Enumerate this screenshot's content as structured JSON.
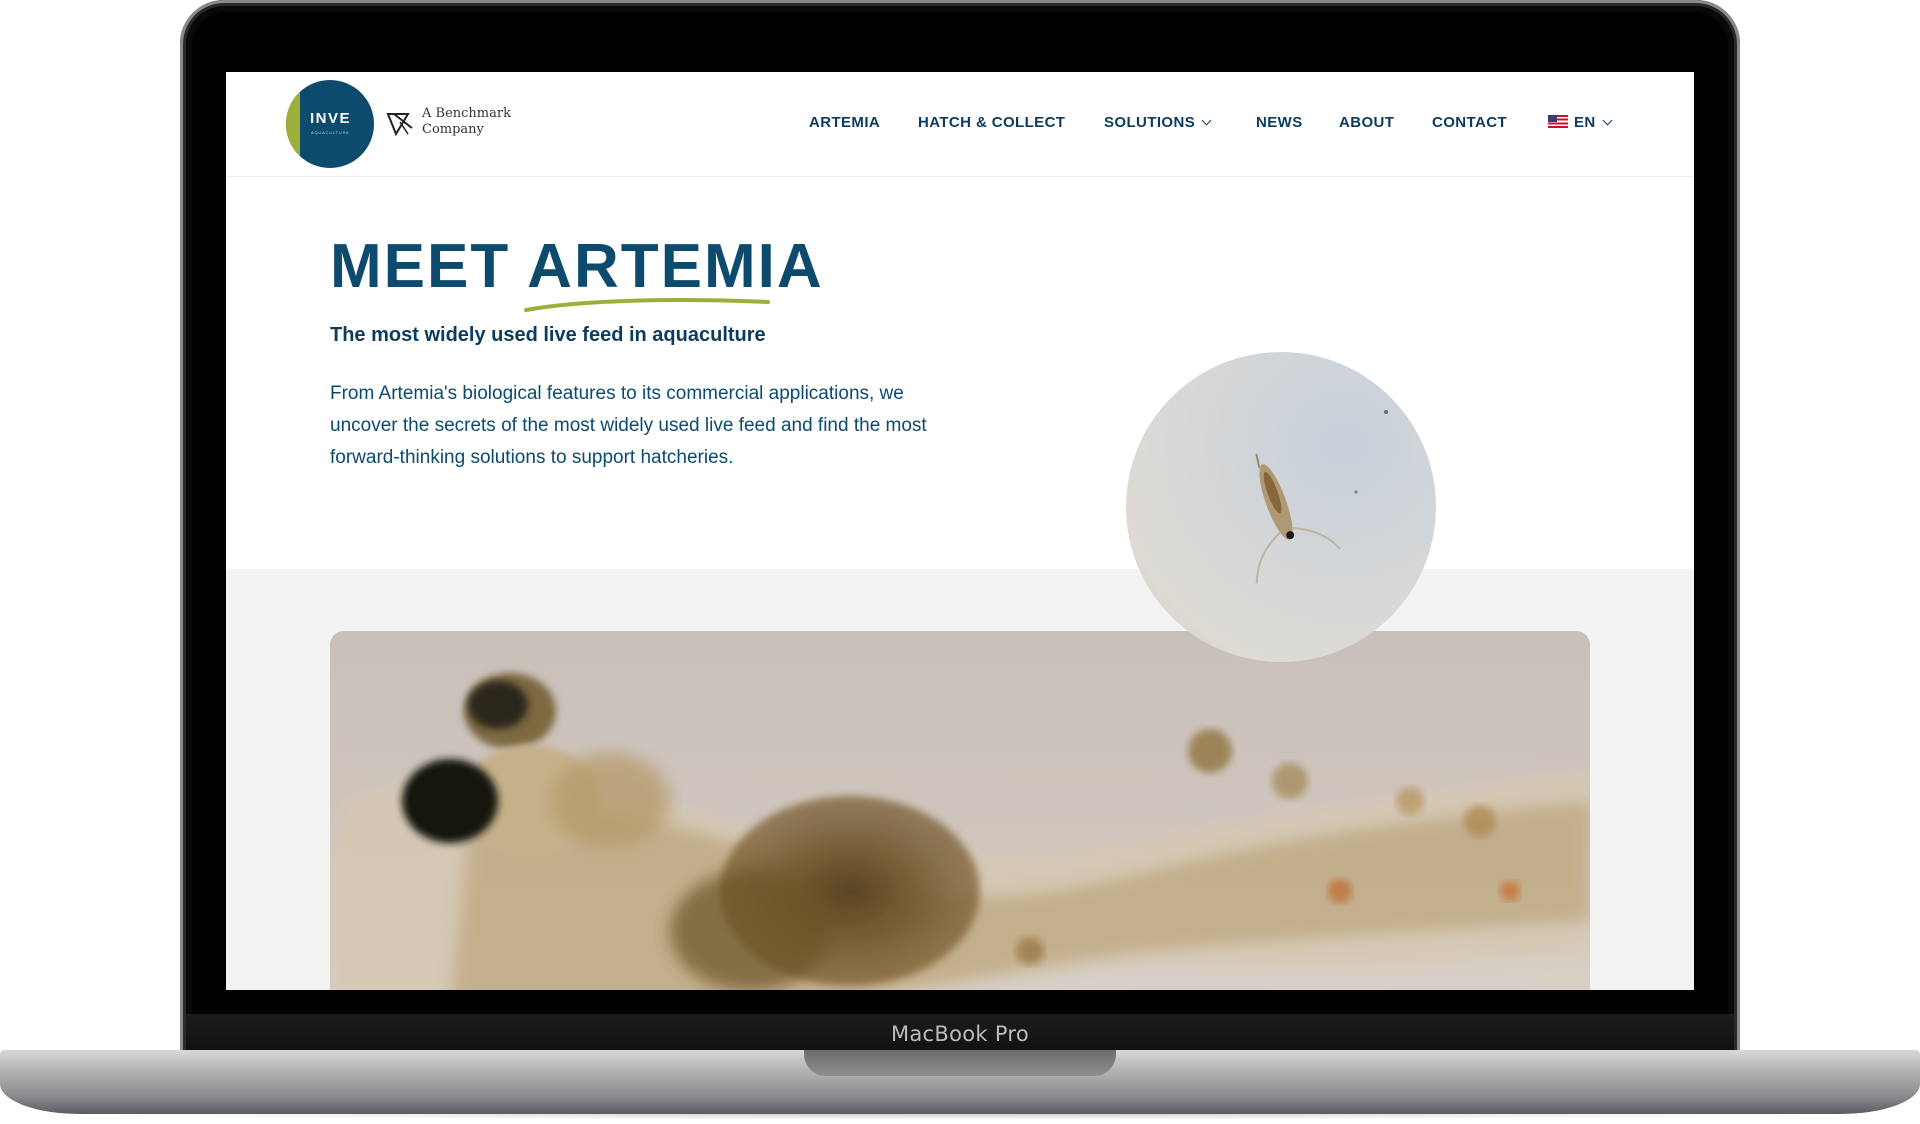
{
  "device": {
    "bezel_label": "MacBook Pro"
  },
  "header": {
    "logo": {
      "brand": "INVE",
      "brand_sub": "AQUACULTURE",
      "parent_line1": "A Benchmark",
      "parent_line2": "Company"
    },
    "nav": [
      {
        "label": "ARTEMIA"
      },
      {
        "label": "HATCH & COLLECT"
      },
      {
        "label": "SOLUTIONS",
        "has_dropdown": true
      },
      {
        "label": "NEWS"
      },
      {
        "label": "ABOUT"
      },
      {
        "label": "CONTACT"
      }
    ],
    "language": {
      "label": "EN",
      "flag": "us-flag-icon"
    }
  },
  "hero": {
    "title_prefix": "MEET",
    "title_highlight": "ARTEMIA",
    "subtitle": "The most widely used live feed in aquaculture",
    "body": "From Artemia's biological features to its commercial applications, we uncover the secrets of the most widely used live feed and find the most forward-thinking solutions to support hatcheries."
  },
  "colors": {
    "brand_navy": "#0c4a6e",
    "brand_green": "#9bb03a",
    "band_grey": "#f3f3f3"
  }
}
